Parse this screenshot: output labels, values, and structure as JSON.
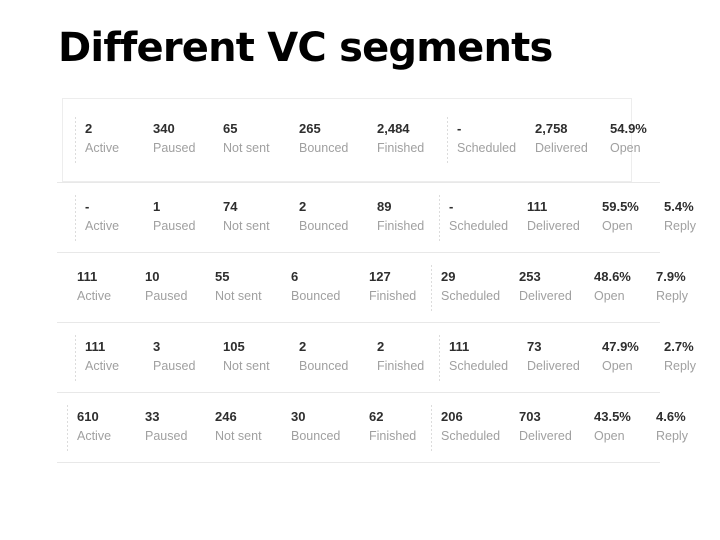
{
  "slide": {
    "title": "Different VC segments",
    "background_color": "#ffffff",
    "value_color": "#2e2e2e",
    "label_color": "#a0a0a0",
    "rule_color": "#e8e8e8"
  },
  "metrics": {
    "active": "Active",
    "paused": "Paused",
    "not_sent": "Not sent",
    "bounced": "Bounced",
    "finished": "Finished",
    "scheduled": "Scheduled",
    "delivered": "Delivered",
    "open": "Open",
    "reply": "Reply"
  },
  "rows": [
    {
      "style": "card",
      "active": "2",
      "paused": "340",
      "not_sent": "65",
      "bounced": "265",
      "finished": "2,484",
      "scheduled": "-",
      "delivered": "2,758",
      "open": "54.9%",
      "reply": null
    },
    {
      "style": "band-indent",
      "active": "-",
      "paused": "1",
      "not_sent": "74",
      "bounced": "2",
      "finished": "89",
      "scheduled": "-",
      "delivered": "111",
      "open": "59.5%",
      "reply": "5.4%"
    },
    {
      "style": "band-flush",
      "active": "111",
      "paused": "10",
      "not_sent": "55",
      "bounced": "6",
      "finished": "127",
      "scheduled": "29",
      "delivered": "253",
      "open": "48.6%",
      "reply": "7.9%"
    },
    {
      "style": "band-indent",
      "active": "111",
      "paused": "3",
      "not_sent": "105",
      "bounced": "2",
      "finished": "2",
      "scheduled": "111",
      "delivered": "73",
      "open": "47.9%",
      "reply": "2.7%"
    },
    {
      "style": "band-flush",
      "active": "610",
      "paused": "33",
      "not_sent": "246",
      "bounced": "30",
      "finished": "62",
      "scheduled": "206",
      "delivered": "703",
      "open": "43.5%",
      "reply": "4.6%"
    }
  ]
}
